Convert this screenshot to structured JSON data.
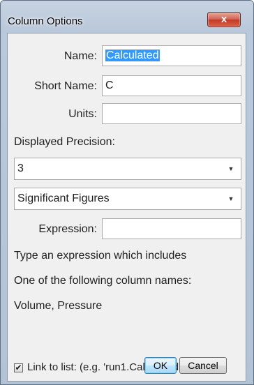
{
  "window": {
    "title": "Column Options",
    "close_glyph": "x"
  },
  "form": {
    "name_label": "Name:",
    "name_value": "Calculated",
    "short_name_label": "Short Name:",
    "short_name_value": "C",
    "units_label": "Units:",
    "units_value": "",
    "precision_label": "Displayed Precision:",
    "precision_value": "3",
    "precision_mode_value": "Significant Figures",
    "expression_label": "Expression:",
    "expression_value": ""
  },
  "info": {
    "line1": "Type an expression which includes",
    "line2": "One of the following column names:",
    "line3": "Volume, Pressure"
  },
  "link": {
    "checked": true,
    "label": "Link to list: (e.g. 'run1.Calculated')"
  },
  "buttons": {
    "ok_label": "OK",
    "cancel_label": "Cancel"
  },
  "colors": {
    "selection": "#3399ff",
    "close_button": "#c43a25",
    "default_button_border": "#3c7fb1"
  },
  "icons": {
    "close": "close-icon",
    "dropdown": "chevron-down-icon",
    "checkbox": "checkmark-icon"
  }
}
